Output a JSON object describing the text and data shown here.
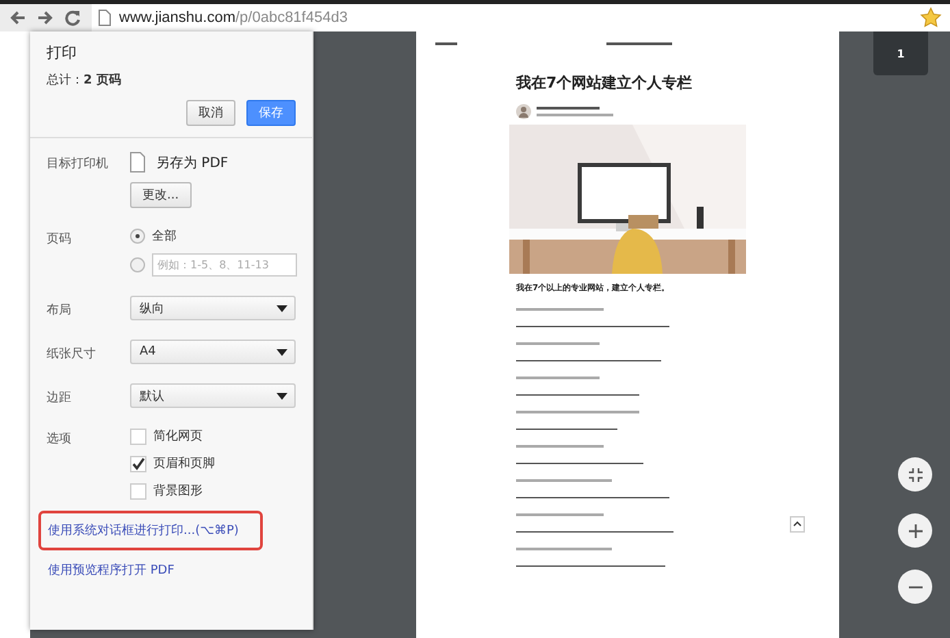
{
  "browser": {
    "url_host": "www.jianshu.com",
    "url_path": "/p/0abc81f454d3"
  },
  "print_dialog": {
    "title": "打印",
    "total": "总计：**2 页码**",
    "cancel": "取消",
    "save": "保存",
    "destination": {
      "label": "目标打印机",
      "value": "另存为 PDF",
      "change": "更改..."
    },
    "pages": {
      "label": "页码",
      "options": [
        {
          "kind": "all",
          "label": "全部",
          "selected": true
        },
        {
          "kind": "custom",
          "placeholder": "例如：1-5、8、11-13",
          "selected": false
        }
      ]
    },
    "selects": [
      {
        "label": "布局",
        "value": "纵向"
      },
      {
        "label": "纸张尺寸",
        "value": "A4"
      },
      {
        "label": "边距",
        "value": "默认"
      }
    ],
    "options": {
      "label": "选项",
      "items": [
        {
          "label": "简化网页",
          "checked": false
        },
        {
          "label": "页眉和页脚",
          "checked": true
        },
        {
          "label": "背景图形",
          "checked": false
        }
      ]
    },
    "links": [
      {
        "text": "使用系统对话框进行打印...(⌥⌘P)",
        "highlighted": true
      },
      {
        "text": "使用预览程序打开 PDF",
        "highlighted": false
      }
    ]
  },
  "preview": {
    "title": "我在7个网站建立个人专栏",
    "subheading": "我在7个以上的专业网站，建立个人专栏。",
    "page_number": "1"
  }
}
